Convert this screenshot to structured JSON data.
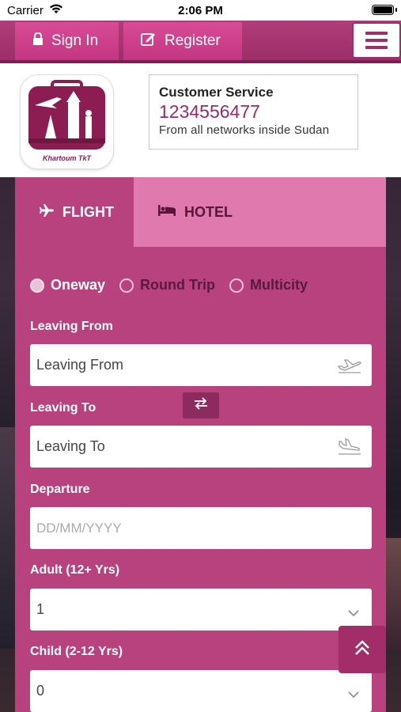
{
  "status_bar": {
    "carrier": "Carrier",
    "time": "2:06 PM"
  },
  "nav": {
    "sign_in": "Sign In",
    "register": "Register"
  },
  "header": {
    "logo_text": "Khartoum TkT",
    "customer_service": {
      "title": "Customer Service",
      "phone": "1234556477",
      "note": "From all networks inside Sudan"
    }
  },
  "tabs": [
    {
      "label": "FLIGHT",
      "active": true
    },
    {
      "label": "HOTEL",
      "active": false
    }
  ],
  "trip_types": [
    {
      "label": "Oneway",
      "selected": true
    },
    {
      "label": "Round Trip",
      "selected": false
    },
    {
      "label": "Multicity",
      "selected": false
    }
  ],
  "form": {
    "leaving_from": {
      "label": "Leaving From",
      "placeholder": "Leaving From"
    },
    "leaving_to": {
      "label": "Leaving To",
      "placeholder": "Leaving To"
    },
    "departure": {
      "label": "Departure",
      "placeholder": "DD/MM/YYYY"
    },
    "adult": {
      "label": "Adult (12+ Yrs)",
      "value": "1"
    },
    "child": {
      "label": "Child (2-12 Yrs)",
      "value": "0"
    }
  },
  "colors": {
    "brand": "#b8427d",
    "brand_dark": "#9c2e68",
    "tab_inactive": "#e07aae",
    "phone": "#9b2a6b"
  },
  "icons": {
    "sign_in": "lock-icon",
    "register": "edit-icon",
    "menu": "hamburger-icon",
    "flight_tab": "plane-icon",
    "hotel_tab": "bed-icon",
    "departure_field": "plane-takeoff-icon",
    "arrival_field": "plane-landing-icon",
    "swap": "swap-icon",
    "dropdown": "chevron-down-icon",
    "scroll_top": "double-chevron-up-icon"
  }
}
